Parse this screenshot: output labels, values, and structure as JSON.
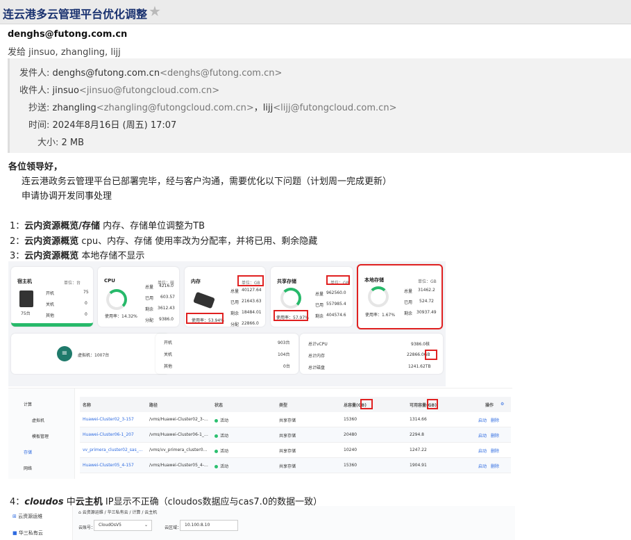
{
  "window": {
    "title": "连云港多云管理平台优化调整",
    "star_icon": "star-icon"
  },
  "mail": {
    "from_display": "denghs@futong.com.cn",
    "to_line": "发给 jinsuo, zhangling, lijj",
    "sender_label": "发件人:",
    "sender_name": "denghs@futong.com.cn",
    "sender_addr": "<denghs@futong.com.cn>",
    "recipient_label": "收件人:",
    "recipient_name": "jinsuo",
    "recipient_addr": "<jinsuo@futongcloud.com.cn>",
    "cc_label": "抄送:",
    "cc_1_name": "zhangling",
    "cc_1_addr": "<zhangling@futongcloud.com.cn>",
    "cc_sep": "，",
    "cc_2_name": "lijj",
    "cc_2_addr": "<lijj@futongcloud.com.cn>",
    "time_label": "时间:",
    "time_value": "2024年8月16日 (周五) 17:07",
    "size_label": "大小:",
    "size_value": "2 MB"
  },
  "body": {
    "greeting": "各位领导好，",
    "line1": "连云港政务云管理平台已部署完毕，经与客户沟通，需要优化以下问题（计划周一完成更新）",
    "line2": "申请协调开发同事处理",
    "item1_num": "1：",
    "item1_bold": "云内资源概览/存储",
    "item1_text": " 内存、存储单位调整为TB",
    "item2_num": "2：",
    "item2_bold": "云内资源概览",
    "item2_text": " cpu、内存、存储 使用率改为分配率，并将已用、剩余隐藏",
    "item3_num": "3：",
    "item3_bold": "云内资源概览",
    "item3_text": " 本地存储不显示",
    "item4_num": "4：",
    "item4_ital": "cloudos",
    "item4_mid": " 中",
    "item4_bold": "云主机",
    "item4_text": " IP显示不正确（cloudos数据应与cas7.0的数据一致）"
  },
  "shot1": {
    "host": {
      "title": "宿主机",
      "unit": "单位：台",
      "count": "75台",
      "on_label": "开机",
      "on_val": "75",
      "off_label": "关机",
      "off_val": "0",
      "other_label": "其他",
      "other_val": "0"
    },
    "cpu": {
      "title": "CPU",
      "unit": "单位：核",
      "total_l": "总量",
      "total_v": "4216.0",
      "used_l": "已用",
      "used_v": "603.57",
      "free_l": "剩余",
      "free_v": "3612.43",
      "alloc_l": "分配",
      "alloc_v": "9386.0",
      "rate": "使用率：14.32%"
    },
    "mem": {
      "title": "内存",
      "unit": "单位：GB",
      "total_l": "总量",
      "total_v": "40127.64",
      "used_l": "已用",
      "used_v": "21643.63",
      "free_l": "剩余",
      "free_v": "18484.01",
      "alloc_l": "分配",
      "alloc_v": "22866.0",
      "rate": "使用率：53.94%"
    },
    "shared": {
      "title": "共享存储",
      "unit": "单位：GB",
      "total_l": "总量",
      "total_v": "962560.0",
      "used_l": "已用",
      "used_v": "557985.4",
      "free_l": "剩余",
      "free_v": "404574.6",
      "rate": "使用率：57.97%"
    },
    "local": {
      "title": "本地存储",
      "unit": "单位：GB",
      "total_l": "总量",
      "total_v": "31462.2",
      "used_l": "已用",
      "used_v": "524.72",
      "free_l": "剩余",
      "free_v": "30937.49",
      "rate": "使用率：1.67%"
    },
    "vm": {
      "label": "虚拟机：1007台",
      "on_l": "开机",
      "on_v": "903台",
      "off_l": "关机",
      "off_v": "104台",
      "other_l": "其他",
      "other_v": "0台"
    },
    "summary": {
      "cpu_l": "总计vCPU",
      "cpu_v": "9386.0核",
      "mem_l": "总计内存",
      "mem_v": "22866.0GB",
      "disk_l": "总计磁盘",
      "disk_v": "1241.62TB"
    }
  },
  "shot2": {
    "side": [
      "计算",
      "虚拟机",
      "模板管理",
      "存储",
      "网络"
    ],
    "headers": {
      "name": "名称",
      "path": "路径",
      "status": "状态",
      "type": "类型",
      "total": "总容量(GB)",
      "avail": "可用容量(GB)",
      "ops": "操作"
    },
    "rows": [
      {
        "name": "Huawei-Cluster02_3-157",
        "path": "/vms/Huawei-Cluster02_3-…",
        "status": "活动",
        "type": "共享存储",
        "total": "15360",
        "avail": "1314.66",
        "op1": "启动",
        "op2": "删除"
      },
      {
        "name": "Huawei-Cluster06-1_207",
        "path": "/vms/Huawei-Cluster06-1_…",
        "status": "活动",
        "type": "共享存储",
        "total": "20480",
        "avail": "2294.8",
        "op1": "启动",
        "op2": "删除"
      },
      {
        "name": "vv_primera_cluster02_sas_…",
        "path": "/vms/vv_primera_cluster0…",
        "status": "活动",
        "type": "共享存储",
        "total": "10240",
        "avail": "1247.22",
        "op1": "启动",
        "op2": "删除"
      },
      {
        "name": "Huawei-Cluster05_4-157",
        "path": "/vms/Huawei-Cluster05_4-…",
        "status": "活动",
        "type": "共享存储",
        "total": "15360",
        "avail": "1904.91",
        "op1": "启动",
        "op2": "删除"
      }
    ]
  },
  "shot3": {
    "app": "云资源运维",
    "sub": "华三私有云",
    "crumb": "云资源运维 / 华三私有云 / 计算 / 云主机",
    "f1_label": "云账号：",
    "f1_value": "CloudOsV5",
    "f2_label": "云区域：",
    "f2_value": "10.100.8.10"
  },
  "colors": {
    "accent": "#1a3270",
    "green": "#27b96a",
    "red": "#e02020",
    "link": "#2d6ae0"
  }
}
